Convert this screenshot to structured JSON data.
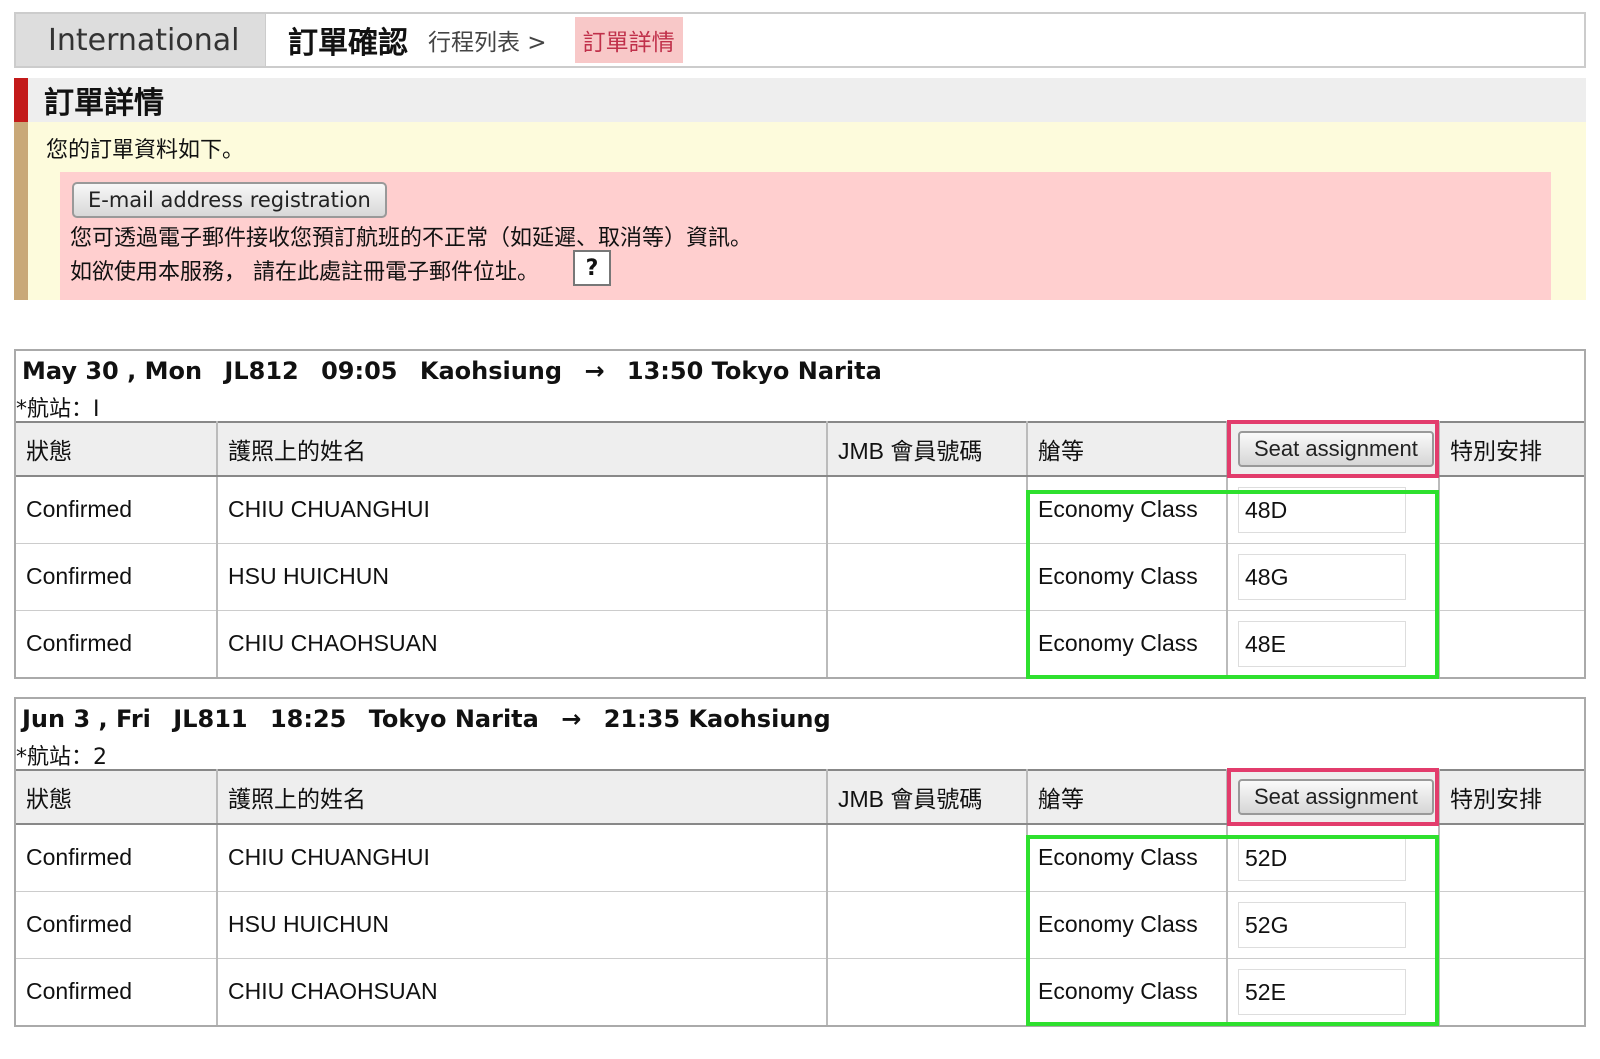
{
  "topbar": {
    "region_tab": "International",
    "title": "訂單確認",
    "crumb": "行程列表 >",
    "current": "訂單詳情"
  },
  "section": {
    "heading": "訂單詳情",
    "intro": "您的訂單資料如下。",
    "email_button": "E-mail address registration",
    "line1": "您可透過電子郵件接收您預訂航班的不正常（如延遲、取消等）資訊。",
    "line2": "如欲使用本服務，  請在此處註冊電子郵件位址。",
    "help_label": "?"
  },
  "columns": {
    "status": "狀態",
    "name": "護照上的姓名",
    "jmb": "JMB 會員號碼",
    "class": "艙等",
    "seat_button": "Seat assignment",
    "special": "特別安排"
  },
  "flights": [
    {
      "date": "May 30 , Mon",
      "flight_no": "JL812",
      "dep_time": "09:05",
      "dep_city": "Kaohsiung",
      "arrow": "→",
      "arr": "13:50 Tokyo Narita",
      "segment": "*航站：I",
      "rows": [
        {
          "status": "Confirmed",
          "name": "CHIU CHUANGHUI",
          "jmb": "",
          "class": "Economy Class",
          "seat": "48D"
        },
        {
          "status": "Confirmed",
          "name": "HSU HUICHUN",
          "jmb": "",
          "class": "Economy Class",
          "seat": "48G"
        },
        {
          "status": "Confirmed",
          "name": "CHIU CHAOHSUAN",
          "jmb": "",
          "class": "Economy Class",
          "seat": "48E"
        }
      ]
    },
    {
      "date": "Jun 3 , Fri",
      "flight_no": "JL811",
      "dep_time": "18:25",
      "dep_city": "Tokyo Narita",
      "arrow": "→",
      "arr": "21:35 Kaohsiung",
      "segment": "*航站：2",
      "rows": [
        {
          "status": "Confirmed",
          "name": "CHIU CHUANGHUI",
          "jmb": "",
          "class": "Economy Class",
          "seat": "52D"
        },
        {
          "status": "Confirmed",
          "name": "HSU HUICHUN",
          "jmb": "",
          "class": "Economy Class",
          "seat": "52G"
        },
        {
          "status": "Confirmed",
          "name": "CHIU CHAOHSUAN",
          "jmb": "",
          "class": "Economy Class",
          "seat": "52E"
        }
      ]
    }
  ]
}
